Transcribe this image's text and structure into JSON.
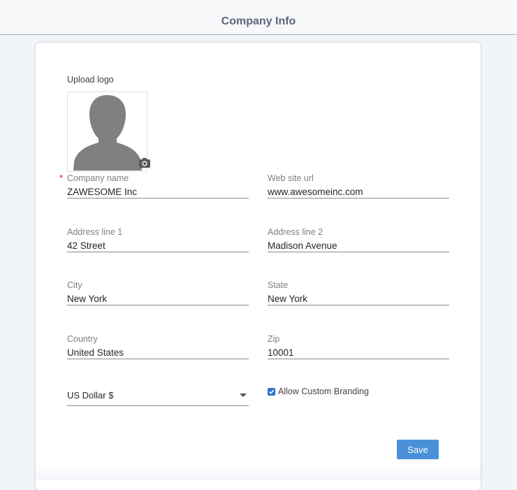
{
  "header": {
    "title": "Company Info"
  },
  "upload": {
    "label": "Upload logo",
    "avatar_icon": "person-silhouette-icon",
    "camera_icon": "camera-icon"
  },
  "fields": {
    "company_name": {
      "label": "Company name",
      "value": "ZAWESOME Inc",
      "required": true
    },
    "website_url": {
      "label": "Web site url",
      "value": "www.awesomeinc.com"
    },
    "address_line1": {
      "label": "Address line 1",
      "value": "42 Street"
    },
    "address_line2": {
      "label": "Address line 2",
      "value": "Madison Avenue"
    },
    "city": {
      "label": "City",
      "value": "New York"
    },
    "state": {
      "label": "State",
      "value": "New York"
    },
    "country": {
      "label": "Country",
      "value": "United States"
    },
    "zip": {
      "label": "Zip",
      "value": "10001"
    }
  },
  "currency": {
    "selected": "US Dollar $"
  },
  "branding": {
    "label": "Allow Custom Branding",
    "checked": true
  },
  "actions": {
    "save_label": "Save"
  },
  "colors": {
    "accent": "#4a90d9",
    "checkbox": "#2d73d2",
    "required": "#d0021b",
    "header_border": "#9fb4d1"
  }
}
